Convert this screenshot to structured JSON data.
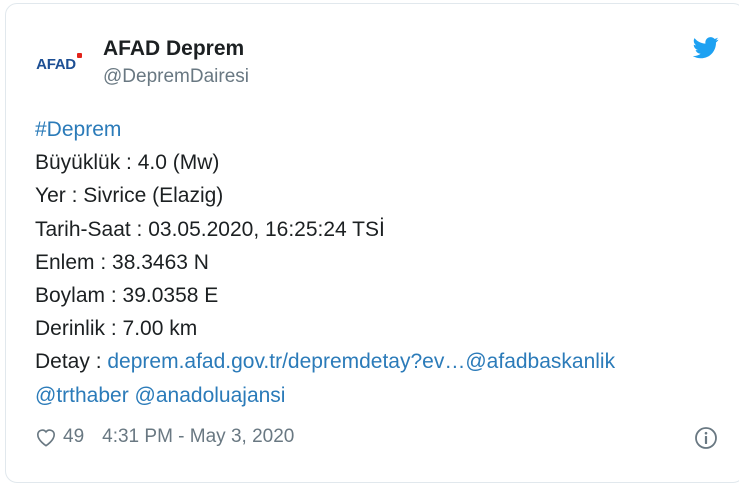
{
  "tweet": {
    "account_name": "AFAD Deprem",
    "handle": "@DepremDairesi",
    "avatar_text": "AFAD",
    "hashtag": "#Deprem",
    "lines": {
      "magnitude": "Büyüklük : 4.0 (Mw)",
      "location": "Yer : Sivrice (Elazig)",
      "datetime": "Tarih-Saat : 03.05.2020, 16:25:24 TSİ",
      "latitude": "Enlem : 38.3463 N",
      "longitude": "Boylam : 39.0358 E",
      "depth": "Derinlik : 7.00 km",
      "detail_label": "Detay : "
    },
    "detail_link": "deprem.afad.gov.tr/depremdetay?ev…",
    "mention_afadbaskanlik": "@afadbaskanlik",
    "mention_trthaber": "@trthaber",
    "mention_anadoluajansi": "@anadoluajansi",
    "like_count": "49",
    "timestamp": "4:31 PM - May 3, 2020"
  },
  "colors": {
    "link": "#2b7bb9",
    "text": "#1c2022",
    "muted": "#697882",
    "twitter_blue": "#1da1f2",
    "afad_blue": "#1d4f94",
    "afad_red": "#e2231a"
  },
  "icons": {
    "brand": "twitter-bird-icon",
    "like": "heart-icon",
    "info": "info-icon"
  }
}
